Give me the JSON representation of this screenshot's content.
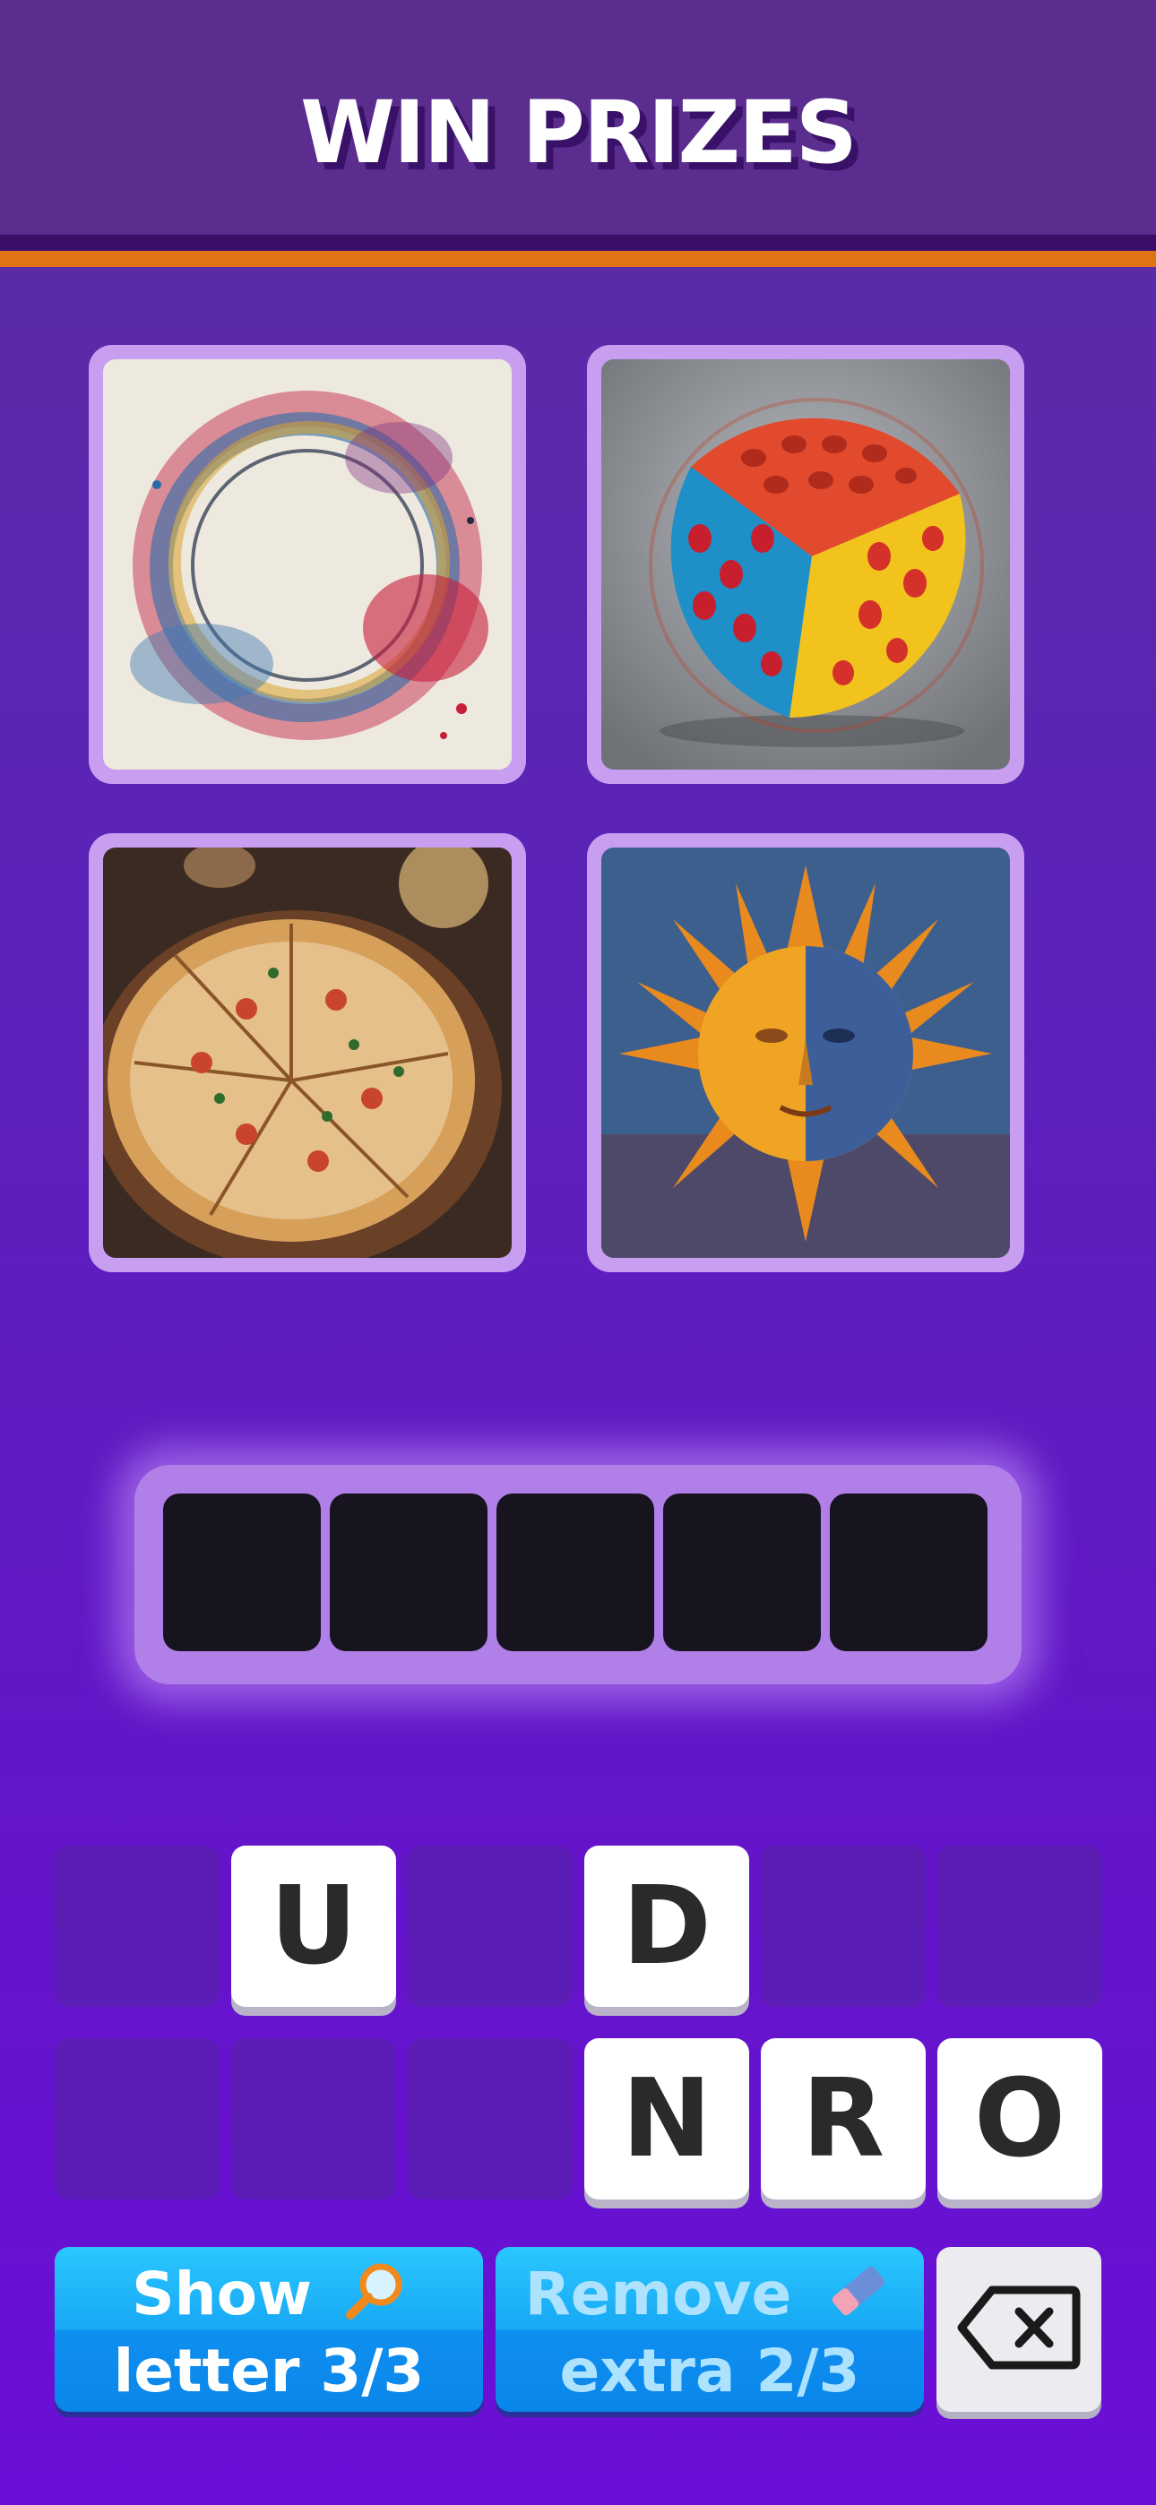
{
  "header": {
    "title": "WIN PRIZES"
  },
  "images": [
    {
      "name": "watercolor-circle-image"
    },
    {
      "name": "ball-image"
    },
    {
      "name": "pizza-image"
    },
    {
      "name": "sun-painting-image"
    }
  ],
  "answer": {
    "slots": [
      "",
      "",
      "",
      "",
      ""
    ]
  },
  "keyboard": {
    "row1": [
      "",
      "U",
      "",
      "D",
      "",
      ""
    ],
    "row2": [
      "",
      "",
      "",
      "N",
      "R",
      "O"
    ]
  },
  "buttons": {
    "show_letter": {
      "line1": "Show",
      "line2": "letter 3/3",
      "icon": "magnifier-icon"
    },
    "remove_extra": {
      "line1": "Remove",
      "line2": "extra 2/3",
      "icon": "eraser-icon"
    },
    "delete": {
      "icon": "backspace-icon"
    }
  }
}
